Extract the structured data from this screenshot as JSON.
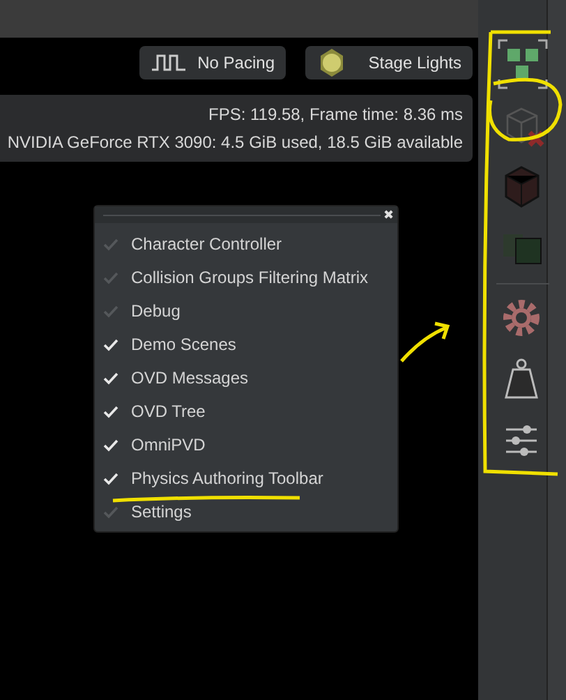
{
  "toolbar_buttons": [
    {
      "label": "No Pacing"
    },
    {
      "label": "Stage Lights"
    }
  ],
  "stats": {
    "fps": "FPS: 119.58, Frame time: 8.36 ms",
    "gpu": "NVIDIA GeForce RTX 3090: 4.5 GiB used, 18.5 GiB available"
  },
  "menu": {
    "close": "✖",
    "items": [
      {
        "label": "Character Controller",
        "checked": false
      },
      {
        "label": "Collision Groups Filtering Matrix",
        "checked": false
      },
      {
        "label": "Debug",
        "checked": false
      },
      {
        "label": "Demo Scenes",
        "checked": true
      },
      {
        "label": "OVD Messages",
        "checked": true
      },
      {
        "label": "OVD Tree",
        "checked": true
      },
      {
        "label": "OmniPVD",
        "checked": true
      },
      {
        "label": "Physics Authoring Toolbar",
        "checked": true
      },
      {
        "label": "Settings",
        "checked": false
      }
    ]
  },
  "side_toolbar": [
    {
      "kind": "select"
    },
    {
      "kind": "remove"
    },
    {
      "kind": "box"
    },
    {
      "kind": "boxes"
    },
    {
      "kind": "divider"
    },
    {
      "kind": "gear"
    },
    {
      "kind": "weight"
    },
    {
      "kind": "sliders"
    }
  ]
}
